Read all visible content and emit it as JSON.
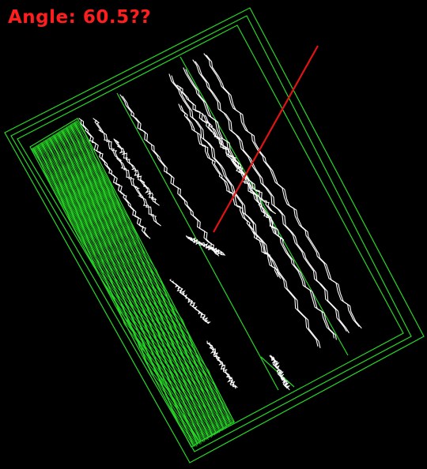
{
  "overlay": {
    "angle_label": "Angle:  60.5??",
    "angle_color": "#ff1e1e",
    "contour_color": "#28d828",
    "edge_color": "#ffffff",
    "background": "#000000"
  },
  "document": {
    "kind": "tilted id card edge-detection view",
    "skew_angle_deg": 60.5
  }
}
